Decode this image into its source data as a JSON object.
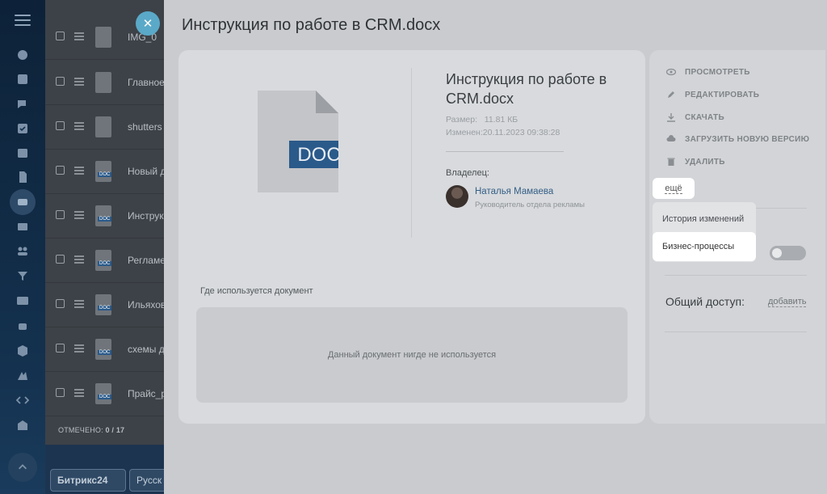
{
  "panel": {
    "title": "Инструкция по работе в CRM.docx",
    "close_glyph": "✕"
  },
  "document": {
    "badge": "DOC",
    "title": "Инструкция по работе в CRM.docx",
    "size_label": "Размер:",
    "size_value": "11.81 КБ",
    "modified_label": "Изменен:",
    "modified_value": "20.11.2023 09:38:28",
    "owner_label": "Владелец:",
    "owner_name": "Наталья Мамаева",
    "owner_role": "Руководитель отдела рекламы",
    "usage_label": "Где используется документ",
    "usage_empty": "Данный документ нигде не используется"
  },
  "actions": {
    "view": "ПРОСМОТРЕТЬ",
    "edit": "РЕДАКТИРОВАТЬ",
    "download": "СКАЧАТЬ",
    "upload": "ЗАГРУЗИТЬ НОВУЮ ВЕРСИЮ",
    "delete": "УДАЛИТЬ",
    "more": "ещё"
  },
  "more_menu": {
    "history": "История изменений",
    "business_processes": "Бизнес-процессы"
  },
  "sharing": {
    "label": "Общий доступ:",
    "add": "добавить"
  },
  "file_list": {
    "rows": [
      {
        "name": "IMG_0"
      },
      {
        "name": "Главное"
      },
      {
        "name": "shutters"
      },
      {
        "name": "Новый д"
      },
      {
        "name": "Инструк"
      },
      {
        "name": "Регламе"
      },
      {
        "name": "Ильяхов"
      },
      {
        "name": "схемы д"
      },
      {
        "name": "Прайс_р"
      }
    ],
    "footer_label": "ОТМЕЧЕНО:",
    "footer_value": "0 / 17"
  },
  "bottom": {
    "brand": "Битрикс24",
    "lang": "Русск"
  },
  "colors": {
    "doc_badge": "#2a5a8a",
    "link": "#355f86",
    "close": "#5aa9c8"
  }
}
